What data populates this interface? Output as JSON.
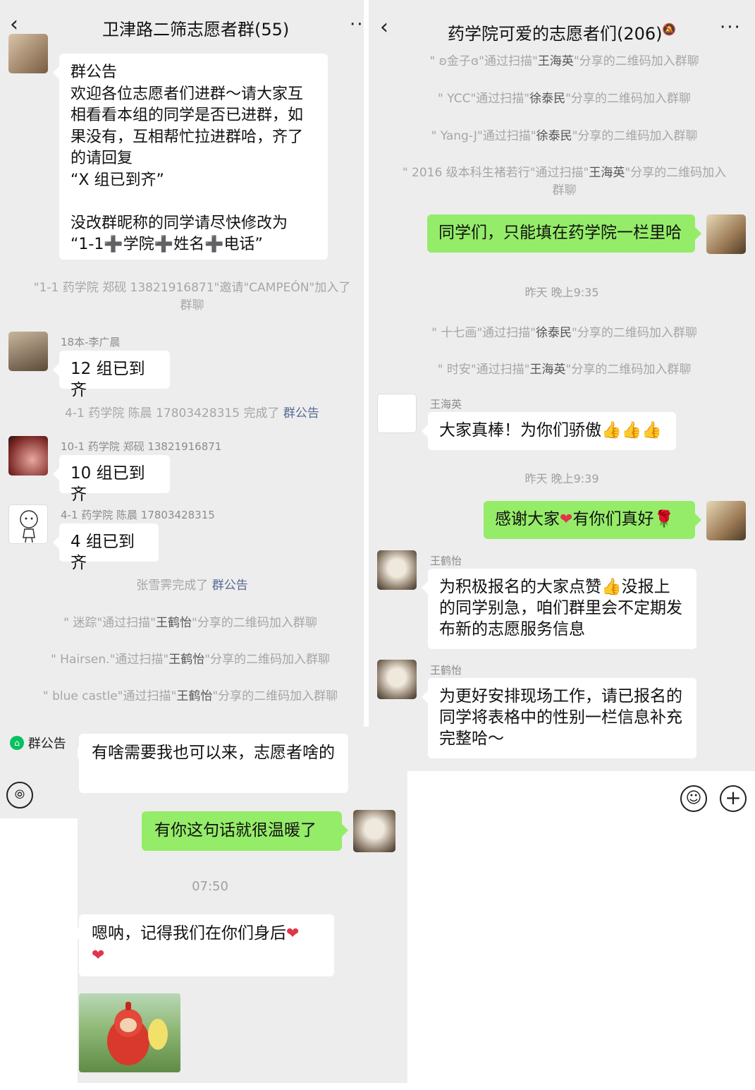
{
  "left": {
    "title": "卫津路二筛志愿者群(55)",
    "announcement": "群公告\n欢迎各位志愿者们进群～请大家互相看看本组的同学是否已进群，如果没有，互相帮忙拉进群哈，齐了的请回复\n“X 组已到齐”\n\n没改群昵称的同学请尽快修改为\n“1-1➕学院➕姓名➕电话”",
    "sys1": "\"1-1 药学院 郑砚 13821916871\"邀请\"CAMPEÓN\"加入了群聊",
    "msg1": {
      "sender": "18本-李广晨",
      "text": "12 组已到齐"
    },
    "sys2_prefix": "4-1 药学院 陈晨 17803428315 完成了",
    "sys2_link": "群公告",
    "msg2": {
      "sender": "10-1 药学院 郑砚 13821916871",
      "text": "10 组已到齐"
    },
    "msg3": {
      "sender": "4-1 药学院 陈晨 17803428315",
      "text": "4 组已到齐"
    },
    "sys3_prefix": "张雪霁完成了",
    "sys3_link": "群公告",
    "sys4": {
      "a": "\" 迷踪\"通过扫描\"",
      "b": "王鹤怡",
      "c": "\"分享的二维码加入群聊"
    },
    "sys5": {
      "a": "\" Hairsen.\"通过扫描\"",
      "b": "王鹤怡",
      "c": "\"分享的二维码加入群聊"
    },
    "sys6": {
      "a": "\" blue castle\"通过扫描\"",
      "b": "王鹤怡",
      "c": "\"分享的二维码加入群聊"
    },
    "notice_label": "群公告"
  },
  "right": {
    "title": "药学院可爱的志愿者们(206)",
    "sys1": {
      "a": "\" ʚ金子ɞ\"通过扫描\"",
      "b": "王海英",
      "c": "\"分享的二维码加入群聊"
    },
    "sys2": {
      "a": "\" YCC\"通过扫描\"",
      "b": "徐泰民",
      "c": "\"分享的二维码加入群聊"
    },
    "sys3": {
      "a": "\" Yang-J\"通过扫描\"",
      "b": "徐泰民",
      "c": "\"分享的二维码加入群聊"
    },
    "sys4": {
      "a": "\" 2016 级本科生褚若行\"通过扫描\"",
      "b": "王海英",
      "c": "\"分享的二维码加入群聊"
    },
    "msg_self1": "同学们，只能填在药学院一栏里哈",
    "time1": "昨天 晚上9:35",
    "sys5": {
      "a": "\" 十七画\"通过扫描\"",
      "b": "徐泰民",
      "c": "\"分享的二维码加入群聊"
    },
    "sys6": {
      "a": "\" 时安\"通过扫描\"",
      "b": "王海英",
      "c": "\"分享的二维码加入群聊"
    },
    "msg_wang": {
      "sender": "王海英",
      "text": "大家真棒！为你们骄傲👍👍👍"
    },
    "time2": "昨天 晚上9:39",
    "msg_self2_a": "感谢大家",
    "msg_self2_b": "有你们真好🌹",
    "msg_he1": {
      "sender": "王鹤怡",
      "text": "为积极报名的大家点赞👍没报上的同学别急，咱们群里会不定期发布新的志愿服务信息"
    },
    "msg_he2": {
      "sender": "王鹤怡",
      "text": "为更好安排现场工作，请已报名的同学将表格中的性别一栏信息补充完整哈～"
    }
  },
  "bottom": {
    "msg1": "有啥需要我也可以来，志愿者啥的",
    "msg_self": "有你这句话就很温暖了",
    "time": "07:50",
    "msg2": "嗯呐，记得我们在你们身后"
  }
}
